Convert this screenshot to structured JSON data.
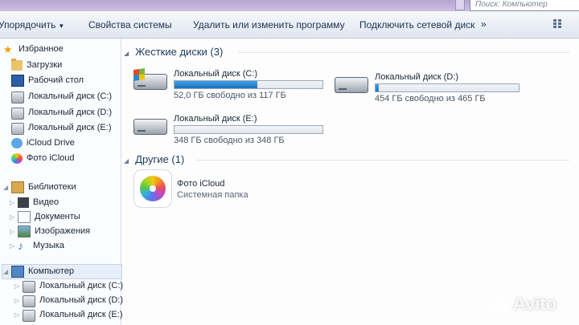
{
  "search": {
    "placeholder": "Поиск: Компьютер"
  },
  "toolbar": {
    "organize": "Упорядочить",
    "system_properties": "Свойства системы",
    "uninstall": "Удалить или изменить программу",
    "map_drive": "Подключить сетевой диск",
    "more": "»"
  },
  "nav": {
    "favorites": "Избранное",
    "downloads": "Загрузки",
    "desktop": "Рабочий стол",
    "drive_c": "Локальный диск (C:)",
    "drive_d": "Локальный диск (D:)",
    "drive_e": "Локальный диск (E:)",
    "icloud_drive": "iCloud Drive",
    "icloud_photos": "Фото iCloud",
    "libraries": "Библиотеки",
    "video": "Видео",
    "documents": "Документы",
    "pictures": "Изображения",
    "music": "Музыка",
    "computer": "Компьютер",
    "comp_c": "Локальный диск (C:)",
    "comp_d": "Локальный диск (D:)",
    "comp_e": "Локальный диск (E:)"
  },
  "content": {
    "hdd_group": "Жесткие диски (3)",
    "other_group": "Другие (1)",
    "drives": [
      {
        "name": "Локальный диск (C:)",
        "free": "52,0 ГБ свободно из 117 ГБ",
        "used_fraction": 0.56
      },
      {
        "name": "Локальный диск (D:)",
        "free": "454 ГБ свободно из 465 ГБ",
        "used_fraction": 0.02
      },
      {
        "name": "Локальный диск (E:)",
        "free": "348 ГБ свободно из 348 ГБ",
        "used_fraction": 0.0
      }
    ],
    "icloud": {
      "name": "Фото iCloud",
      "type": "Системная папка"
    }
  },
  "watermark": "Avito",
  "colors": {
    "bar_fill": "#1a6fc0",
    "accent": "#1e395b"
  }
}
